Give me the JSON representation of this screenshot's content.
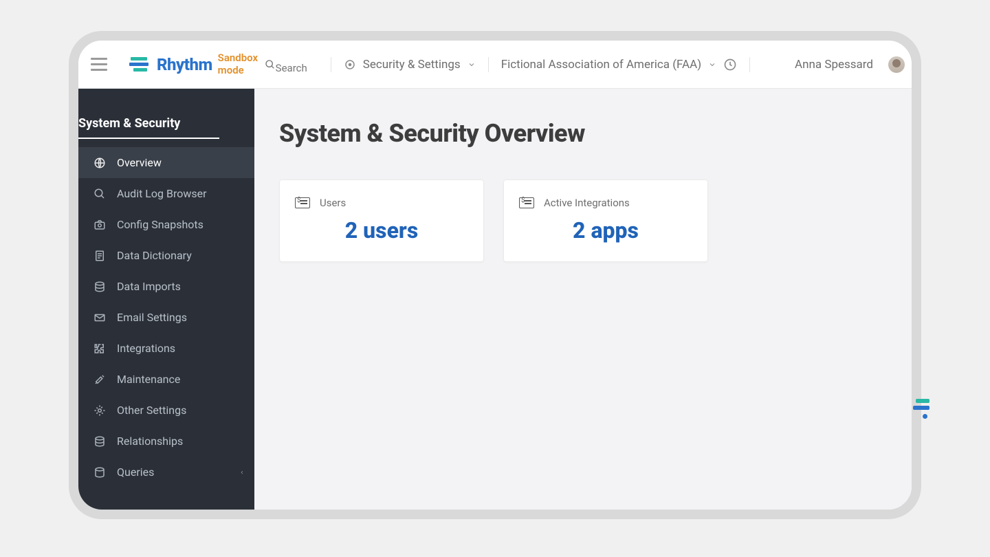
{
  "header": {
    "brand": "Rhythm",
    "sandbox": "Sandbox mode",
    "search_label": "Search",
    "nav_context": "Security & Settings",
    "org": "Fictional Association of America (FAA)",
    "user_name": "Anna Spessard"
  },
  "sidebar": {
    "section_title": "System & Security",
    "items": [
      {
        "label": "Overview",
        "icon": "globe-icon",
        "active": true
      },
      {
        "label": "Audit Log Browser",
        "icon": "search-icon"
      },
      {
        "label": "Config Snapshots",
        "icon": "camera-icon"
      },
      {
        "label": "Data Dictionary",
        "icon": "document-icon"
      },
      {
        "label": "Data Imports",
        "icon": "database-icon"
      },
      {
        "label": "Email Settings",
        "icon": "envelope-icon"
      },
      {
        "label": "Integrations",
        "icon": "puzzle-icon"
      },
      {
        "label": "Maintenance",
        "icon": "tools-icon"
      },
      {
        "label": "Other Settings",
        "icon": "gear-icon"
      },
      {
        "label": "Relationships",
        "icon": "database-icon"
      },
      {
        "label": "Queries",
        "icon": "database-icon",
        "submrow": true
      }
    ]
  },
  "main": {
    "title": "System & Security Overview",
    "cards": [
      {
        "label": "Users",
        "value": "2 users"
      },
      {
        "label": "Active Integrations",
        "value": "2 apps"
      }
    ]
  }
}
